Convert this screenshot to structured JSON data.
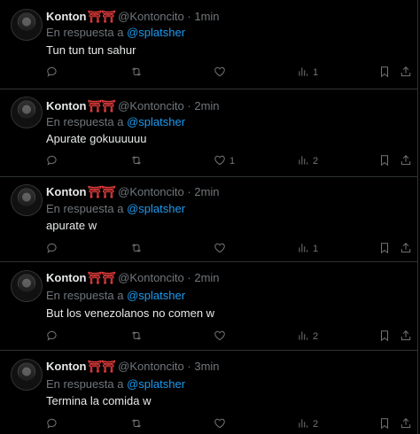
{
  "author": {
    "name": "Konton",
    "emoji": "⛩⛩",
    "handle": "@Kontoncito",
    "dot": "·"
  },
  "reply_prefix": "En respuesta a",
  "reply_user": "@splatsher",
  "more_label": "···",
  "tweets": [
    {
      "time": "1min",
      "show_reply": true,
      "text": "Tun tun tun sahur",
      "replies": "",
      "retweets": "",
      "likes": "",
      "views": "1"
    },
    {
      "time": "2min",
      "show_reply": true,
      "text": "Apurate gokuuuuuu",
      "replies": "",
      "retweets": "",
      "likes": "1",
      "views": "2"
    },
    {
      "time": "2min",
      "show_reply": true,
      "text": "apurate w",
      "replies": "",
      "retweets": "",
      "likes": "",
      "views": "1"
    },
    {
      "time": "2min",
      "show_reply": true,
      "text": "But los venezolanos no comen w",
      "replies": "",
      "retweets": "",
      "likes": "",
      "views": "2"
    },
    {
      "time": "3min",
      "show_reply": true,
      "text": "Termina la comida w",
      "replies": "",
      "retweets": "",
      "likes": "",
      "views": "2"
    }
  ]
}
